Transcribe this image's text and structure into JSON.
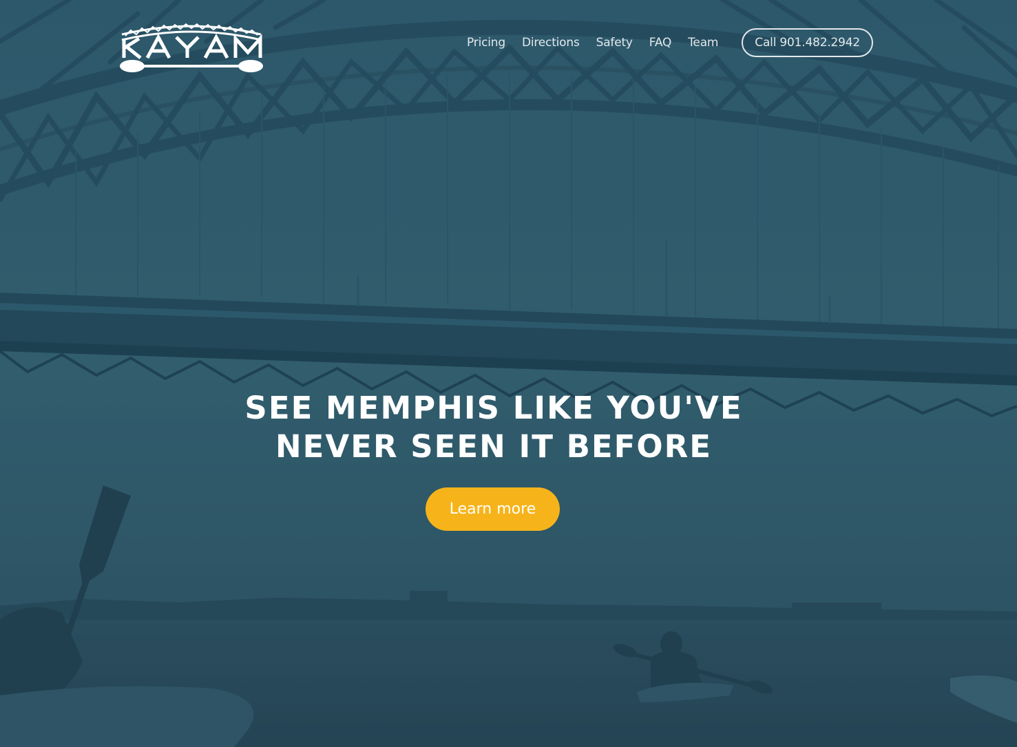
{
  "colors": {
    "overlay": "#2c5466",
    "accent": "#f6b41a",
    "text": "#ffffff",
    "nav_text": "#e3e9ec"
  },
  "header": {
    "logo_text": "KAYAK",
    "nav_items": [
      {
        "label": "Pricing"
      },
      {
        "label": "Directions"
      },
      {
        "label": "Safety"
      },
      {
        "label": "FAQ"
      },
      {
        "label": "Team"
      }
    ],
    "call_label": "Call 901.482.2942"
  },
  "hero": {
    "title_line_1": "See Memphis like you've",
    "title_line_2": "never seen it before",
    "button_label": "Learn more",
    "background_image": "bridge-and-kayakers-photo"
  }
}
